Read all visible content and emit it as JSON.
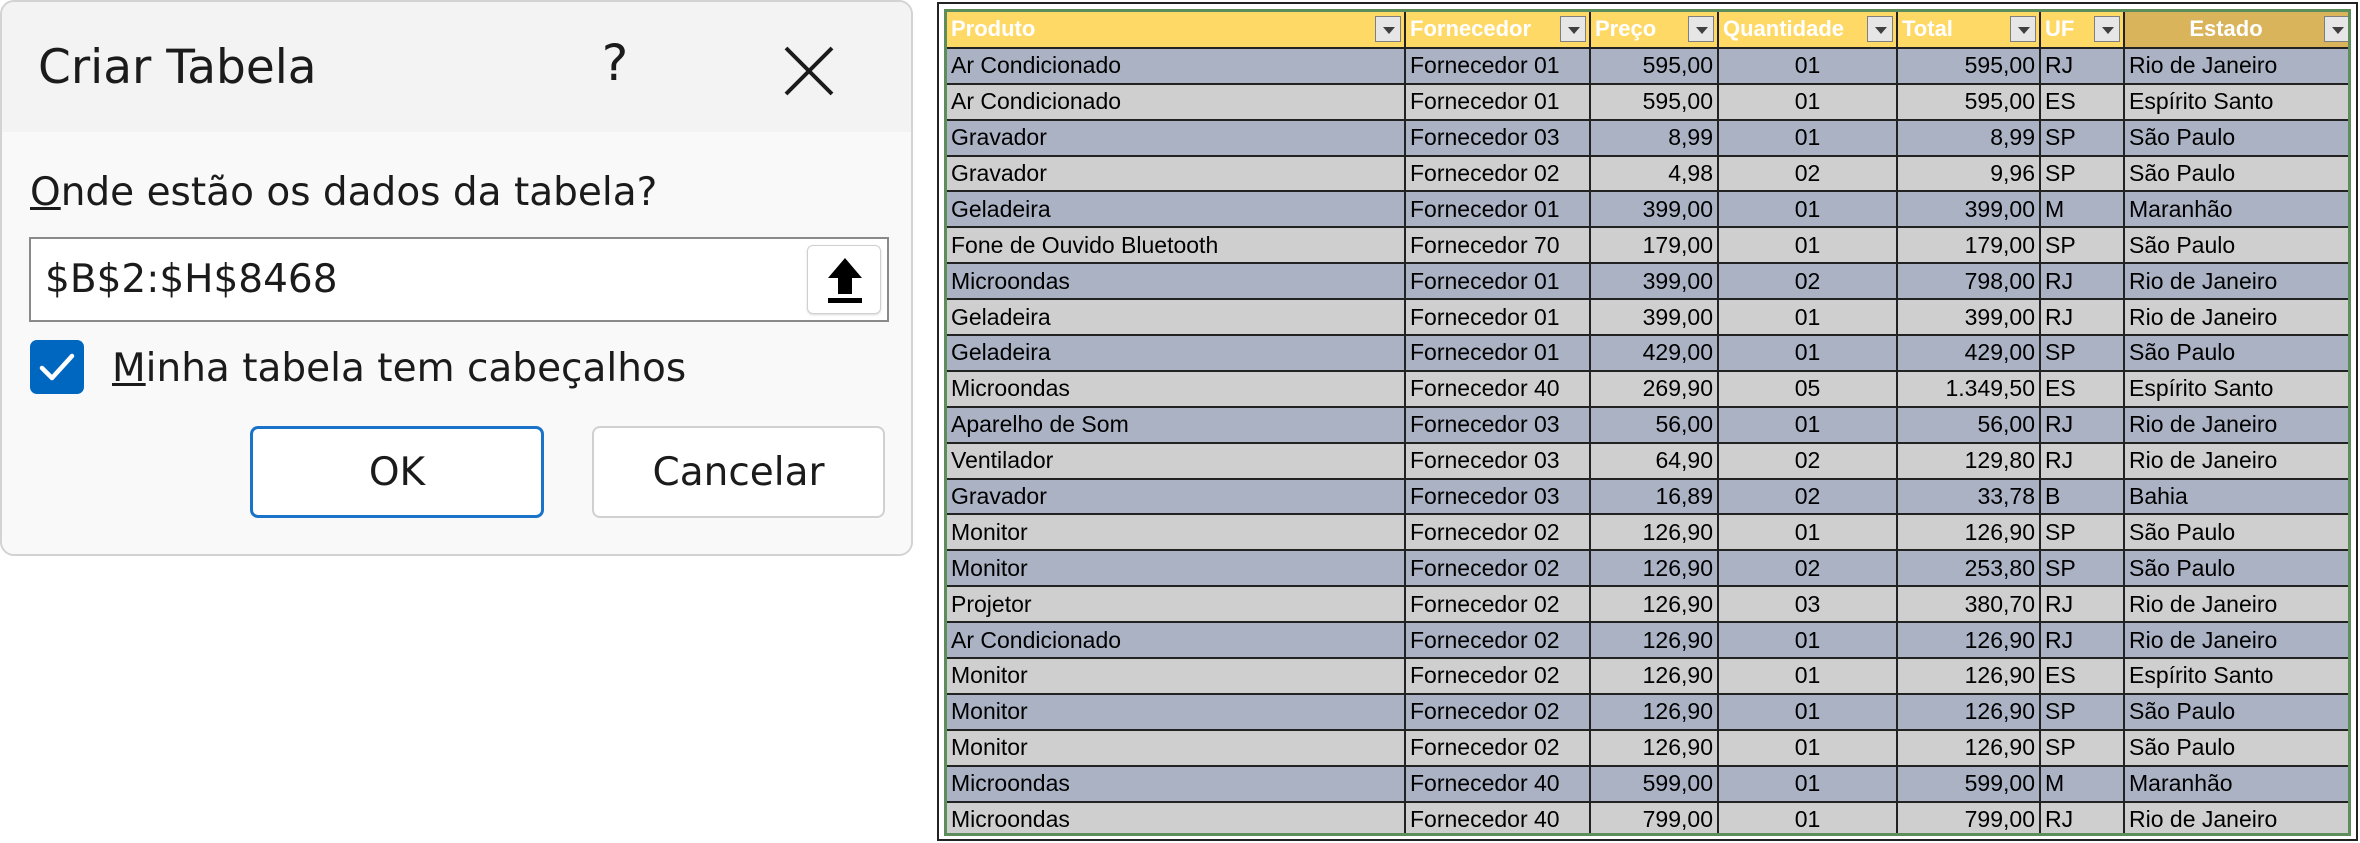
{
  "dialog": {
    "title": "Criar Tabela",
    "help_glyph": "?",
    "range_label_accel": "O",
    "range_label_rest": "nde estão os dados da tabela?",
    "range_value": "$B$2:$H$8468",
    "checkbox_checked": true,
    "checkbox_label_accel": "M",
    "checkbox_label_rest": "inha tabela tem cabeçalhos",
    "ok_label": "OK",
    "cancel_label": "Cancelar"
  },
  "table": {
    "headers": [
      "Produto",
      "Fornecedor",
      "Preço",
      "Quantidade",
      "Total",
      "UF",
      "Estado"
    ],
    "rows": [
      [
        "Ar Condicionado",
        "Fornecedor 01",
        "595,00",
        "01",
        "595,00",
        "RJ",
        "Rio de Janeiro"
      ],
      [
        "Ar Condicionado",
        "Fornecedor 01",
        "595,00",
        "01",
        "595,00",
        "ES",
        "Espírito Santo"
      ],
      [
        "Gravador",
        "Fornecedor 03",
        "8,99",
        "01",
        "8,99",
        "SP",
        "São Paulo"
      ],
      [
        "Gravador",
        "Fornecedor 02",
        "4,98",
        "02",
        "9,96",
        "SP",
        "São Paulo"
      ],
      [
        "Geladeira",
        "Fornecedor 01",
        "399,00",
        "01",
        "399,00",
        "M",
        "Maranhão"
      ],
      [
        "Fone de Ouvido Bluetooth",
        "Fornecedor 70",
        "179,00",
        "01",
        "179,00",
        "SP",
        "São Paulo"
      ],
      [
        "Microondas",
        "Fornecedor 01",
        "399,00",
        "02",
        "798,00",
        "RJ",
        "Rio de Janeiro"
      ],
      [
        "Geladeira",
        "Fornecedor 01",
        "399,00",
        "01",
        "399,00",
        "RJ",
        "Rio de Janeiro"
      ],
      [
        "Geladeira",
        "Fornecedor 01",
        "429,00",
        "01",
        "429,00",
        "SP",
        "São Paulo"
      ],
      [
        "Microondas",
        "Fornecedor 40",
        "269,90",
        "05",
        "1.349,50",
        "ES",
        "Espírito Santo"
      ],
      [
        "Aparelho de Som",
        "Fornecedor 03",
        "56,00",
        "01",
        "56,00",
        "RJ",
        "Rio de Janeiro"
      ],
      [
        "Ventilador",
        "Fornecedor 03",
        "64,90",
        "02",
        "129,80",
        "RJ",
        "Rio de Janeiro"
      ],
      [
        "Gravador",
        "Fornecedor 03",
        "16,89",
        "02",
        "33,78",
        "B",
        "Bahia"
      ],
      [
        "Monitor",
        "Fornecedor 02",
        "126,90",
        "01",
        "126,90",
        "SP",
        "São Paulo"
      ],
      [
        "Monitor",
        "Fornecedor 02",
        "126,90",
        "02",
        "253,80",
        "SP",
        "São Paulo"
      ],
      [
        "Projetor",
        "Fornecedor 02",
        "126,90",
        "03",
        "380,70",
        "RJ",
        "Rio de Janeiro"
      ],
      [
        "Ar Condicionado",
        "Fornecedor 02",
        "126,90",
        "01",
        "126,90",
        "RJ",
        "Rio de Janeiro"
      ],
      [
        "Monitor",
        "Fornecedor 02",
        "126,90",
        "01",
        "126,90",
        "ES",
        "Espírito Santo"
      ],
      [
        "Monitor",
        "Fornecedor 02",
        "126,90",
        "01",
        "126,90",
        "SP",
        "São Paulo"
      ],
      [
        "Monitor",
        "Fornecedor 02",
        "126,90",
        "01",
        "126,90",
        "SP",
        "São Paulo"
      ],
      [
        "Microondas",
        "Fornecedor 40",
        "599,00",
        "01",
        "599,00",
        "M",
        "Maranhão"
      ],
      [
        "Microondas",
        "Fornecedor 40",
        "799,00",
        "01",
        "799,00",
        "RJ",
        "Rio de Janeiro"
      ]
    ]
  },
  "colors": {
    "header_bg": "#ffd966",
    "header_text": "#ffffff",
    "row_odd": "#aab2c4",
    "row_even": "#cfcfcf",
    "checkbox": "#0067c0",
    "ok_border": "#1a73c8"
  },
  "icons": {
    "close": "close-icon",
    "collapse": "upload-arrow-icon",
    "check": "checkmark-icon",
    "filter": "dropdown-arrow-icon"
  }
}
